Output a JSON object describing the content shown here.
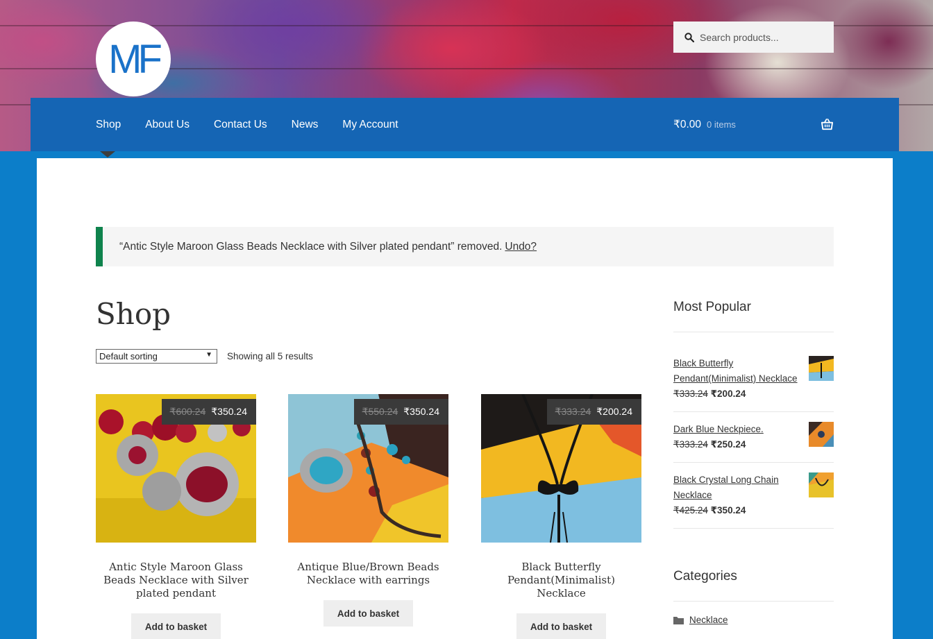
{
  "header": {
    "logo_text": "MF",
    "search_placeholder": "Search products...",
    "nav": [
      {
        "label": "Shop"
      },
      {
        "label": "About Us"
      },
      {
        "label": "Contact Us"
      },
      {
        "label": "News"
      },
      {
        "label": "My Account"
      }
    ],
    "cart_amount": "₹0.00",
    "cart_count": "0 items"
  },
  "notice": {
    "message": "“Antic Style Maroon Glass Beads Necklace with Silver plated pendant” removed.",
    "undo_label": "Undo?"
  },
  "main": {
    "title": "Shop",
    "sort_selected": "Default sorting",
    "result_count": "Showing all 5 results",
    "products": [
      {
        "title": "Antic Style Maroon Glass Beads Necklace with Silver plated pendant",
        "old_price": "₹600.24",
        "price": "₹350.24",
        "button": "Add to basket"
      },
      {
        "title": "Antique Blue/Brown Beads Necklace with earrings",
        "old_price": "₹550.24",
        "price": "₹350.24",
        "button": "Add to basket"
      },
      {
        "title": "Black Butterfly Pendant(Minimalist) Necklace",
        "old_price": "₹333.24",
        "price": "₹200.24",
        "button": "Add to basket"
      }
    ]
  },
  "sidebar": {
    "popular_title": "Most Popular",
    "popular": [
      {
        "name": "Black Butterfly Pendant(Minimalist) Necklace",
        "old_price": "₹333.24",
        "price": "₹200.24"
      },
      {
        "name": "Dark Blue Neckpiece.",
        "old_price": "₹333.24",
        "price": "₹250.24"
      },
      {
        "name": "Black Crystal Long Chain Necklace",
        "old_price": "₹425.24",
        "price": "₹350.24"
      }
    ],
    "categories_title": "Categories",
    "categories": [
      {
        "label": "Necklace"
      }
    ]
  },
  "colors": {
    "navbar": "#1565b4",
    "page_bg": "#0c7ec9",
    "notice_accent": "#0f834d",
    "price_tag_bg": "#3a3a3a"
  }
}
